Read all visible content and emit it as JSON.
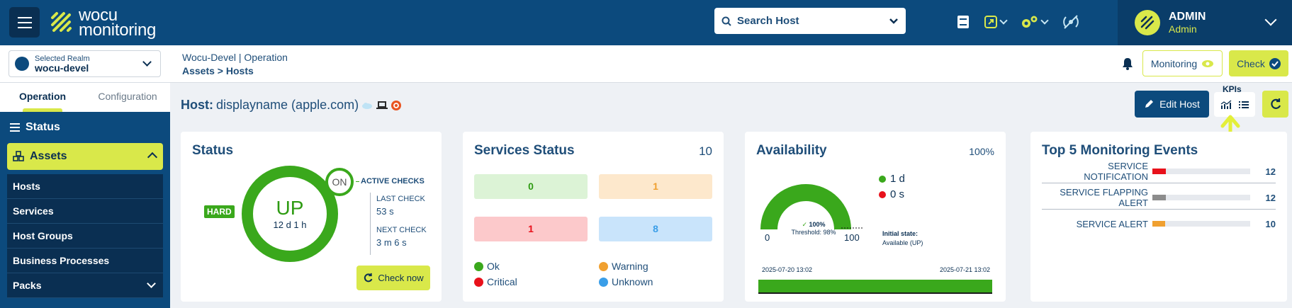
{
  "header": {
    "logo_line1": "wocu",
    "logo_line2": "monitoring",
    "search_placeholder": "Search Host",
    "user_name": "ADMIN",
    "user_role": "Admin"
  },
  "subheader": {
    "realm_label": "Selected Realm",
    "realm_value": "wocu-devel",
    "breadcrumb_top": "Wocu-Devel | Operation",
    "breadcrumb_path": "Assets > Hosts",
    "monitoring_label": "Monitoring",
    "check_label": "Check"
  },
  "sidebar": {
    "tabs": [
      "Operation",
      "Configuration"
    ],
    "status_label": "Status",
    "assets_label": "Assets",
    "items": [
      "Hosts",
      "Services",
      "Host Groups",
      "Business Processes",
      "Packs"
    ]
  },
  "host": {
    "title_prefix": "Host:",
    "title_value": "displayname (apple.com)",
    "edit_label": "Edit Host",
    "kpis_label": "KPIs"
  },
  "status_card": {
    "title": "Status",
    "state": "UP",
    "duration": "12 d 1 h",
    "state_type": "HARD",
    "active_badge": "ON",
    "active_label": "ACTIVE CHECKS",
    "last_check_label": "LAST CHECK",
    "last_check_value": "53 s",
    "next_check_label": "NEXT CHECK",
    "next_check_value": "3 m 6 s",
    "check_now_label": "Check now"
  },
  "services_card": {
    "title": "Services Status",
    "total": "10",
    "ok": "0",
    "warning": "1",
    "critical": "1",
    "unknown": "8",
    "legend": {
      "ok": "Ok",
      "warning": "Warning",
      "critical": "Critical",
      "unknown": "Unknown"
    },
    "colors": {
      "ok": "#2e9b12",
      "warning": "#f0a030",
      "critical": "#e8111b",
      "unknown": "#3a9ee8"
    }
  },
  "availability_card": {
    "title": "Availability",
    "percent": "100%",
    "up_time": "1 d",
    "down_time": "0 s",
    "gauge_value": "100%",
    "threshold": "Threshold: 98%",
    "gauge_min": "0",
    "gauge_max": "100",
    "initial_state_label": "Initial state:",
    "initial_state_value": "Available (UP)",
    "start_date": "2025-07-20 13:02",
    "end_date": "2025-07-21 13:02"
  },
  "events_card": {
    "title": "Top 5 Monitoring Events",
    "events": [
      {
        "name": "SERVICE NOTIFICATION",
        "value": "12",
        "color": "#e8111b",
        "fraction": 0.14
      },
      {
        "name": "SERVICE FLAPPING ALERT",
        "value": "12",
        "color": "#8c8c8c",
        "fraction": 0.14
      },
      {
        "name": "SERVICE ALERT",
        "value": "10",
        "color": "#f0a030",
        "fraction": 0.13
      }
    ]
  }
}
